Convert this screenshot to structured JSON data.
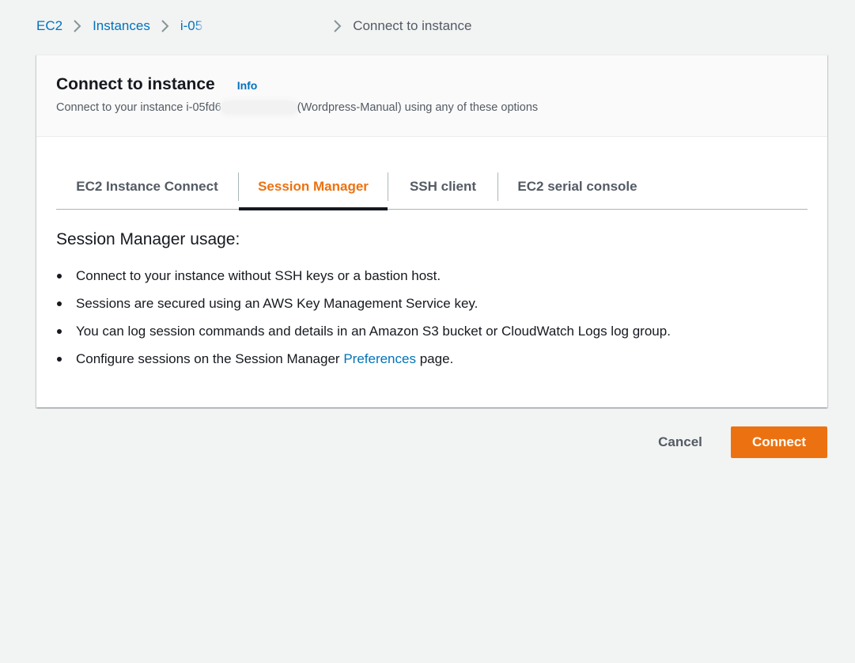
{
  "breadcrumb": {
    "items": [
      {
        "label": "EC2"
      },
      {
        "label": "Instances"
      },
      {
        "label": "i-05"
      }
    ],
    "current": "Connect to instance"
  },
  "header": {
    "title": "Connect to instance",
    "info_label": "Info",
    "subtitle_prefix": "Connect to your instance i-05fd6",
    "subtitle_suffix": "(Wordpress-Manual) using any of these options"
  },
  "tabs": [
    {
      "label": "EC2 Instance Connect",
      "active": false
    },
    {
      "label": "Session Manager",
      "active": true
    },
    {
      "label": "SSH client",
      "active": false
    },
    {
      "label": "EC2 serial console",
      "active": false
    }
  ],
  "usage": {
    "title": "Session Manager usage:",
    "items": [
      "Connect to your instance without SSH keys or a bastion host.",
      "Sessions are secured using an AWS Key Management Service key.",
      "You can log session commands and details in an Amazon S3 bucket or CloudWatch Logs log group."
    ],
    "last_item": {
      "prefix": "Configure sessions on the Session Manager ",
      "link": "Preferences",
      "suffix": " page."
    }
  },
  "actions": {
    "cancel_label": "Cancel",
    "connect_label": "Connect"
  },
  "colors": {
    "accent": "#ec7211",
    "link": "#0073bb",
    "background": "#f2f3f3"
  }
}
